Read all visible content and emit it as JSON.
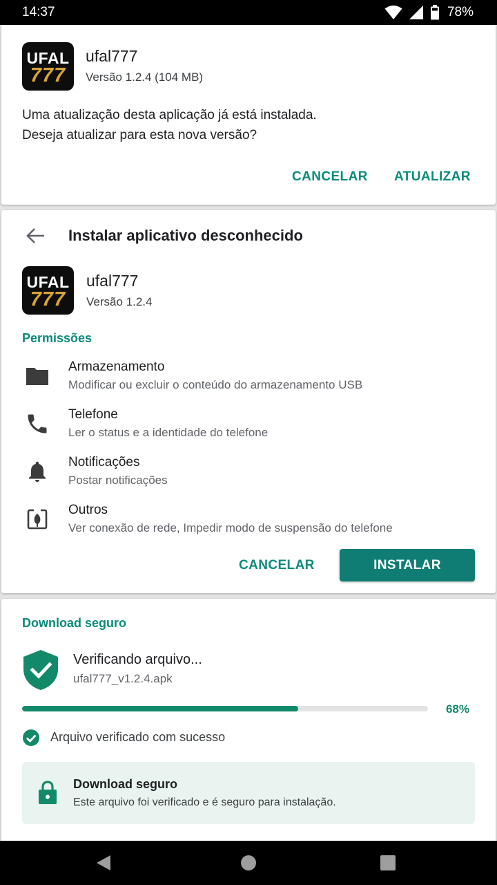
{
  "status_bar": {
    "time": "14:37",
    "battery": "78%",
    "icons": [
      "wifi-icon",
      "signal-icon",
      "battery-icon"
    ]
  },
  "update_dialog": {
    "app_icon_line1": "UFAL",
    "app_icon_line2": "777",
    "app_name": "ufal777",
    "version": "Versão 1.2.4  (104 MB)",
    "message_line1": "Uma atualização desta aplicação já está instalada.",
    "message_line2": "Deseja atualizar para esta nova versão?",
    "cancel_label": "CANCELAR",
    "update_label": "ATUALIZAR"
  },
  "install_dialog": {
    "title": "Instalar aplicativo desconhecido",
    "app_icon_line1": "UFAL",
    "app_icon_line2": "777",
    "app_name": "ufal777",
    "version": "Versão 1.2.4",
    "permissions_label": "Permissões",
    "permissions": [
      {
        "icon": "folder-icon",
        "title": "Armazenamento",
        "desc": "Modificar ou excluir o conteúdo do armazenamento USB"
      },
      {
        "icon": "phone-icon",
        "title": "Telefone",
        "desc": "Ler o status e a identidade do telefone"
      },
      {
        "icon": "bell-icon",
        "title": "Notificações",
        "desc": "Postar notificações"
      },
      {
        "icon": "other-icon",
        "title": "Outros",
        "desc": "Ver conexão de rede, Impedir modo de suspensão do telefone"
      }
    ],
    "cancel_label": "CANCELAR",
    "install_label": "INSTALAR"
  },
  "download_card": {
    "section_label": "Download seguro",
    "verify_title": "Verificando arquivo...",
    "file_name": "ufal777_v1.2.4.apk",
    "progress_percent": 68,
    "progress_text": "68%",
    "check_text": "Arquivo verificado com sucesso",
    "secure_title": "Download seguro",
    "secure_desc": "Este arquivo foi verificado e é seguro para instalação."
  },
  "colors": {
    "accent": "#0b8b7b",
    "install_button": "#0f7d73",
    "progress": "#128a6a",
    "secure_box": "#e9f3ef"
  }
}
